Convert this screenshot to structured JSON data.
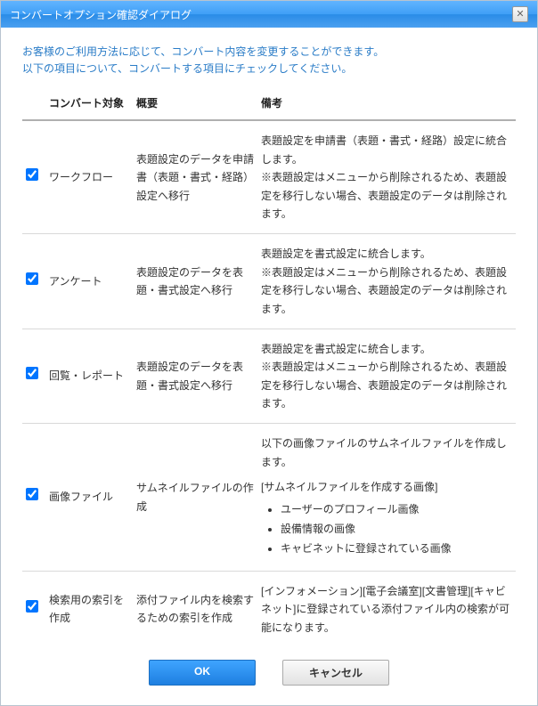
{
  "dialog": {
    "title": "コンバートオプション確認ダイアログ",
    "intro_line1": "お客様のご利用方法に応じて、コンバート内容を変更することができます。",
    "intro_line2": "以下の項目について、コンバートする項目にチェックしてください。"
  },
  "table": {
    "headers": {
      "target": "コンバート対象",
      "overview": "概要",
      "remarks": "備考"
    },
    "rows": [
      {
        "checked": true,
        "target": "ワークフロー",
        "overview": "表題設定のデータを申請書（表題・書式・経路）設定へ移行",
        "remarks": "表題設定を申請書（表題・書式・経路）設定に統合します。\n※表題設定はメニューから削除されるため、表題設定を移行しない場合、表題設定のデータは削除されます。"
      },
      {
        "checked": true,
        "target": "アンケート",
        "overview": "表題設定のデータを表題・書式設定へ移行",
        "remarks": "表題設定を書式設定に統合します。\n※表題設定はメニューから削除されるため、表題設定を移行しない場合、表題設定のデータは削除されます。"
      },
      {
        "checked": true,
        "target": "回覧・レポート",
        "overview": "表題設定のデータを表題・書式設定へ移行",
        "remarks": "表題設定を書式設定に統合します。\n※表題設定はメニューから削除されるため、表題設定を移行しない場合、表題設定のデータは削除されます。"
      },
      {
        "checked": true,
        "target": "画像ファイル",
        "overview": "サムネイルファイルの作成",
        "remarks_intro": "以下の画像ファイルのサムネイルファイルを作成します。",
        "remarks_list_title": "[サムネイルファイルを作成する画像]",
        "remarks_list": [
          "ユーザーのプロフィール画像",
          "設備情報の画像",
          "キャビネットに登録されている画像"
        ]
      },
      {
        "checked": true,
        "target": "検索用の索引を作成",
        "overview": "添付ファイル内を検索するための索引を作成",
        "remarks": "[インフォメーション][電子会議室][文書管理][キャビネット]に登録されている添付ファイル内の検索が可能になります。"
      }
    ]
  },
  "buttons": {
    "ok": "OK",
    "cancel": "キャンセル"
  }
}
